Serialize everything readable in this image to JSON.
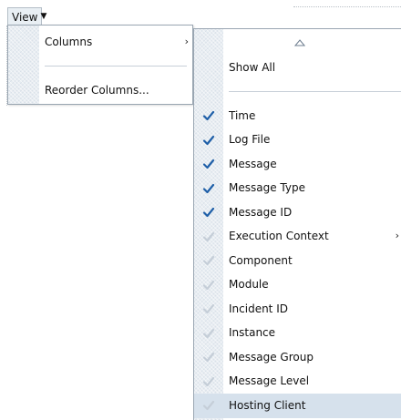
{
  "view_menu": {
    "label": "View",
    "caret_icon": "chevron-down-icon"
  },
  "main_menu": {
    "items": [
      {
        "label": "Columns",
        "has_submenu": true
      },
      {
        "label": "Reorder Columns..."
      }
    ]
  },
  "columns_submenu": {
    "scroll_up_icon": "triangle-up-icon",
    "show_all_label": "Show All",
    "items": [
      {
        "label": "Time",
        "checked": true
      },
      {
        "label": "Log File",
        "checked": true
      },
      {
        "label": "Message",
        "checked": true
      },
      {
        "label": "Message Type",
        "checked": true
      },
      {
        "label": "Message ID",
        "checked": true
      },
      {
        "label": "Execution Context",
        "checked": false,
        "has_submenu": true
      },
      {
        "label": "Component",
        "checked": false
      },
      {
        "label": "Module",
        "checked": false
      },
      {
        "label": "Incident ID",
        "checked": false
      },
      {
        "label": "Instance",
        "checked": false
      },
      {
        "label": "Message Group",
        "checked": false
      },
      {
        "label": "Message Level",
        "checked": false
      },
      {
        "label": "Hosting Client",
        "checked": false,
        "highlighted": true
      }
    ]
  },
  "colors": {
    "checkmark_active": "#1f5fa8",
    "checkmark_inactive": "#c5ced8",
    "highlight": "#d6e1ec",
    "gutter": "#e8edf2",
    "border": "#9aa6b2"
  }
}
